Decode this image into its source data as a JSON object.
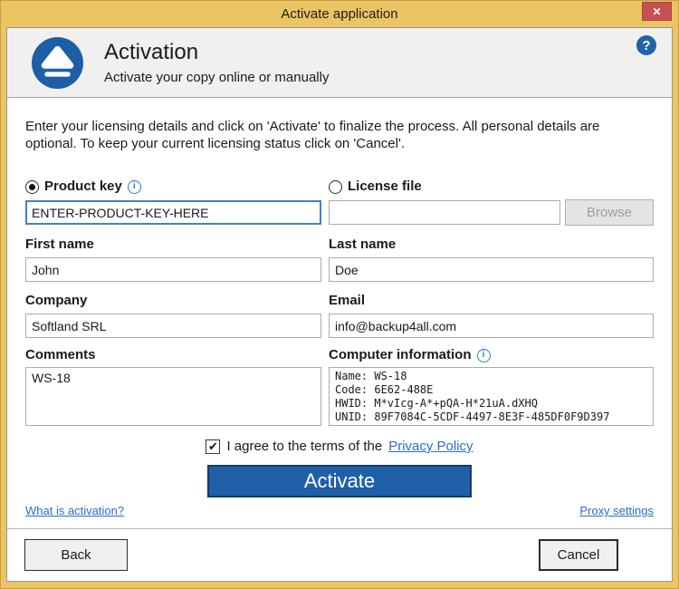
{
  "window": {
    "title": "Activate application"
  },
  "icons": {
    "close": "✕",
    "help": "?",
    "info": "i",
    "check": "✔"
  },
  "colors": {
    "titlebar_gold": "#EBC463",
    "close_red": "#C75050",
    "accent_blue": "#2060A8",
    "logo_blue": "#1C5FA6",
    "link_blue": "#2A6BD2",
    "focused_input_border": "#4080D0"
  },
  "header": {
    "title": "Activation",
    "subtitle": "Activate your copy online or manually"
  },
  "intro": "Enter your licensing details and click on 'Activate' to finalize the process. All personal details are optional. To keep your current licensing status click on 'Cancel'.",
  "form": {
    "product_key": {
      "label": "Product key",
      "value": "ENTER-PRODUCT-KEY-HERE",
      "selected": true
    },
    "license_file": {
      "label": "License file",
      "value": "",
      "selected": false,
      "browse_label": "Browse"
    },
    "first_name": {
      "label": "First name",
      "value": "John"
    },
    "last_name": {
      "label": "Last name",
      "value": "Doe"
    },
    "company": {
      "label": "Company",
      "value": "Softland SRL"
    },
    "email": {
      "label": "Email",
      "value": "info@backup4all.com"
    },
    "comments": {
      "label": "Comments",
      "value": "WS-18"
    },
    "computer_info": {
      "label": "Computer information",
      "value": "Name: WS-18\nCode: 6E62-488E\nHWID: M*vIcg-A*+pQA-H*21uA.dXHQ\nUNID: 89F7084C-5CDF-4497-8E3F-485DF0F9D397"
    }
  },
  "agreement": {
    "checked": true,
    "text": "I agree to the terms of the",
    "link_label": "Privacy Policy"
  },
  "buttons": {
    "activate": "Activate",
    "back": "Back",
    "cancel": "Cancel"
  },
  "links": {
    "what_is_activation": "What is activation?",
    "proxy_settings": "Proxy settings"
  }
}
